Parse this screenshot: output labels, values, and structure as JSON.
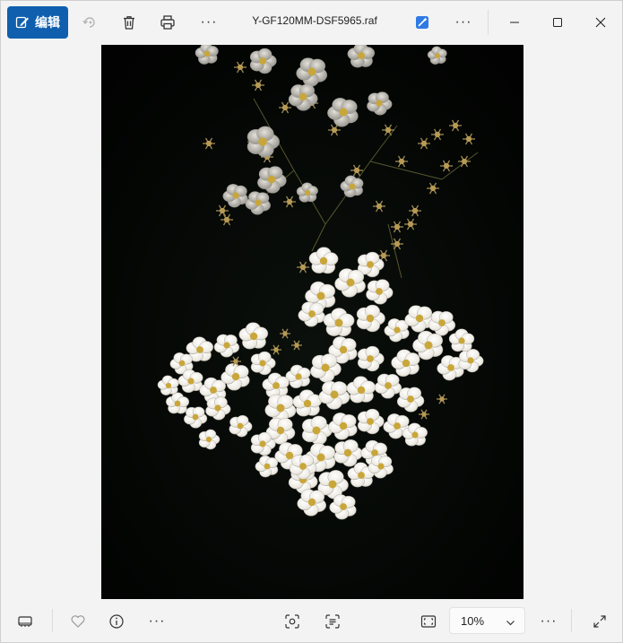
{
  "toolbar": {
    "edit_label": "编辑",
    "title": "Y-GF120MM-DSF5965.raf",
    "more_label": "···",
    "icons": [
      "edit-icon",
      "rotate-icon",
      "delete-icon",
      "print-icon",
      "more-icon",
      "ai-edit-icon",
      "more-icon"
    ]
  },
  "window_controls": [
    "minimize-icon",
    "maximize-icon",
    "close-icon"
  ],
  "bottom": {
    "more_label": "···",
    "zoom_value": "10%",
    "icons": [
      "filmstrip-icon",
      "favorite-icon",
      "info-icon",
      "more-icon",
      "visual-search-icon",
      "text-scan-icon",
      "fit-window-icon",
      "zoom-chevron-icon",
      "fullscreen-icon"
    ]
  },
  "image": {
    "description_icon": "photo-of-white-spirea-flowers",
    "background_color": "#030503",
    "flower_color": "#f4f2ec",
    "center_color": "#c9a63a"
  },
  "colors": {
    "accent": "#0f5fae",
    "chrome": "#f3f3f3"
  }
}
